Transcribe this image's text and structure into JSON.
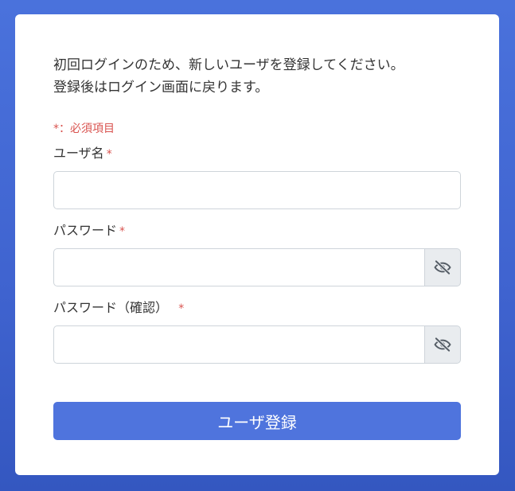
{
  "form": {
    "intro_line1": "初回ログインのため、新しいユーザを登録してください。",
    "intro_line2": "登録後はログイン画面に戻ります。",
    "required_note": "*：必須項目",
    "required_mark": "*",
    "username_label": "ユーザ名",
    "username_value": "",
    "password_label": "パスワード",
    "password_value": "",
    "password_confirm_label": "パスワード（確認）",
    "password_confirm_value": "",
    "submit_label": "ユーザ登録"
  },
  "icons": {
    "toggle_visibility": "eye-slash-icon"
  },
  "colors": {
    "accent": "#4f74dd",
    "required": "#d9534f",
    "background": "#4a72dc"
  }
}
